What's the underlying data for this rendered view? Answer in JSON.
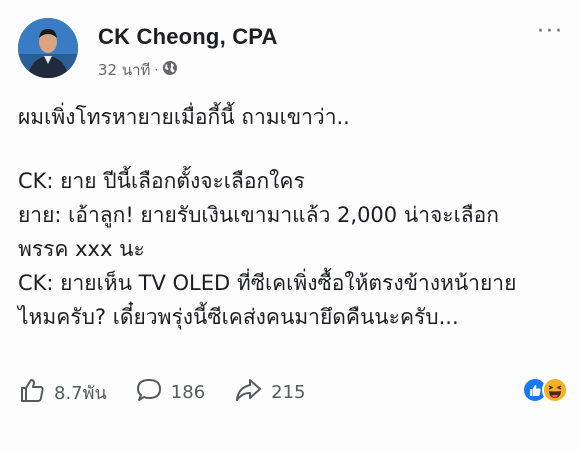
{
  "post": {
    "author": "CK Cheong, CPA",
    "time": "32 นาที",
    "separator": "·",
    "more_label": "···",
    "lines": [
      "ผมเพิ่งโทรหายายเมื่อกี้นี้ ถามเขาว่า..",
      "CK: ยาย ปีนี้เลือกตั้งจะเลือกใคร",
      "ยาย: เอ้าลูก! ยายรับเงินเขามาแล้ว 2,000 น่าจะเลือก",
      "พรรค xxx นะ",
      "CK: ยายเห็น TV OLED ที่ซีเคเพิ่งซื้อให้ตรงข้างหน้ายาย",
      "ไหมครับ? เดี๋ยวพรุ่งนี้ซีเคส่งคนมายึดคืนนะครับ..."
    ]
  },
  "footer": {
    "likes": "8.7พัน",
    "comments": "186",
    "shares": "215"
  },
  "icons": {
    "privacy": "globe-icon",
    "like": "thumbs-up-icon",
    "comment": "comment-icon",
    "share": "share-icon",
    "reaction_like": "like-reaction-icon",
    "reaction_haha": "haha-reaction-icon"
  },
  "colors": {
    "text": "#1c1e21",
    "muted": "#65676b",
    "like_blue": "#1877f2",
    "haha_yellow": "#f7b125"
  }
}
